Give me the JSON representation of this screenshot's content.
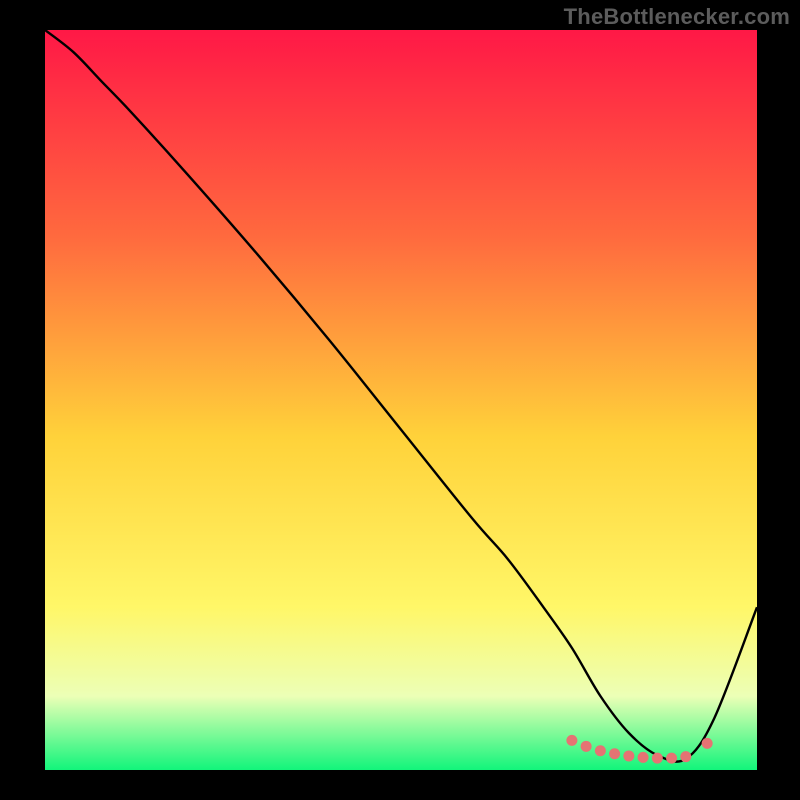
{
  "attribution": "TheBottlenecker.com",
  "colors": {
    "gradient_top": "#ff1846",
    "gradient_mid1": "#ff6a3e",
    "gradient_mid2": "#ffd23a",
    "gradient_mid3": "#fff768",
    "gradient_mid4": "#ecffb6",
    "gradient_bot": "#12f57b",
    "curve": "#000000",
    "marker": "#e57373",
    "frame_bg": "#000000"
  },
  "chart_data": {
    "type": "line",
    "title": "",
    "xlabel": "",
    "ylabel": "",
    "xlim": [
      0,
      100
    ],
    "ylim": [
      0,
      100
    ],
    "series": [
      {
        "name": "bottleneck-curve",
        "x": [
          0,
          4,
          8,
          12,
          20,
          30,
          40,
          50,
          60,
          65,
          70,
          74,
          78,
          82,
          86,
          90,
          94,
          100
        ],
        "y": [
          100,
          97,
          93,
          89,
          80.5,
          69.5,
          58,
          46,
          34,
          28.5,
          22,
          16.5,
          10,
          5,
          2,
          1.5,
          7,
          22
        ]
      }
    ],
    "markers": {
      "name": "optimal-range",
      "x": [
        74,
        76,
        78,
        80,
        82,
        84,
        86,
        88,
        90,
        93
      ],
      "y": [
        4.0,
        3.2,
        2.6,
        2.2,
        1.9,
        1.7,
        1.6,
        1.6,
        1.8,
        3.6
      ]
    },
    "gradient_stops": [
      {
        "offset": 0.0,
        "color": "#ff1846"
      },
      {
        "offset": 0.28,
        "color": "#ff6a3e"
      },
      {
        "offset": 0.55,
        "color": "#ffd23a"
      },
      {
        "offset": 0.78,
        "color": "#fff768"
      },
      {
        "offset": 0.9,
        "color": "#ecffb6"
      },
      {
        "offset": 1.0,
        "color": "#12f57b"
      }
    ]
  }
}
